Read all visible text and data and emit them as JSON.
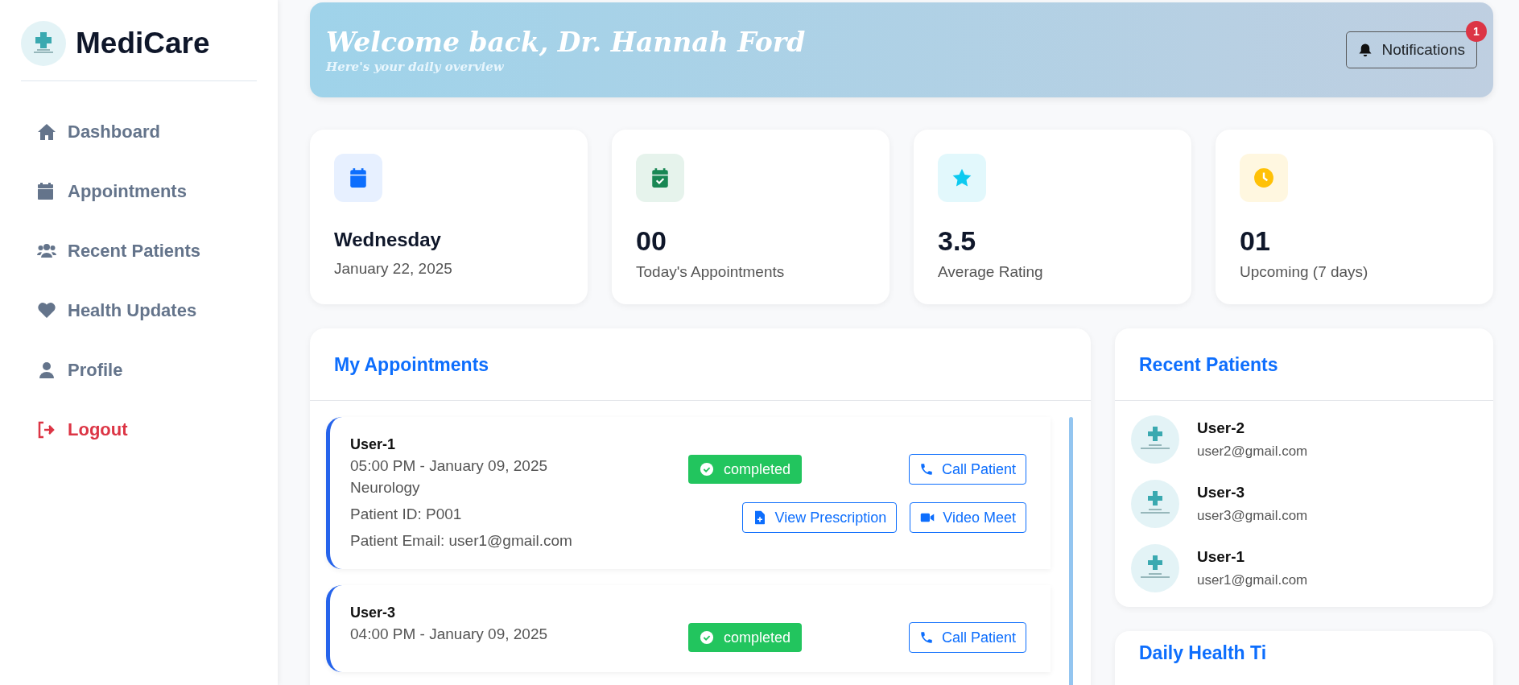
{
  "brand": {
    "name": "MediCare"
  },
  "nav": [
    {
      "label": "Dashboard",
      "kind": "home"
    },
    {
      "label": "Appointments",
      "kind": "calendar"
    },
    {
      "label": "Recent Patients",
      "kind": "users"
    },
    {
      "label": "Health Updates",
      "kind": "heart"
    },
    {
      "label": "Profile",
      "kind": "user"
    },
    {
      "label": "Logout",
      "kind": "logout"
    }
  ],
  "header": {
    "title": "Welcome back, Dr. Hannah Ford",
    "subtitle": "Here's your daily overview",
    "notifications": {
      "label": "Notifications",
      "count": "1"
    }
  },
  "stats": [
    {
      "kind": "day",
      "value": "Wednesday",
      "label": "January 22, 2025"
    },
    {
      "kind": "today",
      "value": "00",
      "label": "Today's Appointments"
    },
    {
      "kind": "rating",
      "value": "3.5",
      "label": "Average Rating"
    },
    {
      "kind": "upcoming",
      "value": "01",
      "label": "Upcoming (7 days)"
    }
  ],
  "appointments": {
    "title": "My Appointments",
    "items": [
      {
        "patient": "User-1",
        "time": "05:00 PM - January 09, 2025",
        "department": "Neurology",
        "patient_id": "Patient ID: P001",
        "email": "Patient Email: user1@gmail.com",
        "status": "completed",
        "actions": [
          {
            "kind": "call",
            "label": "Call Patient"
          },
          {
            "kind": "prescription",
            "label": "View Prescription"
          },
          {
            "kind": "video",
            "label": "Video Meet"
          }
        ]
      },
      {
        "patient": "User-3",
        "time": "04:00 PM - January 09, 2025",
        "status": "completed",
        "actions": [
          {
            "kind": "call",
            "label": "Call Patient"
          }
        ]
      }
    ]
  },
  "recent_patients": {
    "title": "Recent Patients",
    "items": [
      {
        "name": "User-2",
        "email": "user2@gmail.com"
      },
      {
        "name": "User-3",
        "email": "user3@gmail.com"
      },
      {
        "name": "User-1",
        "email": "user1@gmail.com"
      }
    ]
  },
  "tips": {
    "title": "Daily Health Ti"
  }
}
